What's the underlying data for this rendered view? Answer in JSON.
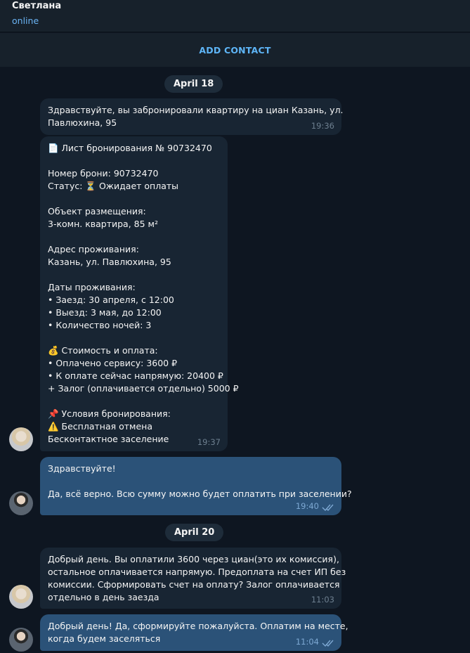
{
  "header": {
    "name": "Светлана",
    "status": "online",
    "add_contact": "ADD CONTACT"
  },
  "dates": [
    "April 18",
    "April 20"
  ],
  "messages": [
    {
      "dir": "in",
      "lines": [
        "Здравствуйте, вы забронировали квартиру на циан Казань, ул.",
        "Павлюхина, 95"
      ],
      "time": "19:36"
    },
    {
      "dir": "in",
      "lines": [
        "📄 Лист бронирования № 90732470",
        "",
        "Номер брони: 90732470",
        "Статус: ⏳ Ожидает оплаты",
        "",
        "Объект размещения:",
        "3-комн. квартира, 85 м²",
        "",
        "Адрес проживания:",
        "Казань, ул. Павлюхина, 95",
        "",
        "Даты проживания:",
        "• Заезд: 30 апреля, с 12:00",
        "• Выезд: 3 мая, до 12:00",
        "• Количество ночей: 3",
        "",
        "💰 Стоимость и оплата:",
        "• Оплачено сервису: 3600 ₽",
        "• К оплате сейчас напрямую: 20400 ₽",
        "+ Залог (оплачивается отдельно) 5000 ₽",
        "",
        "📌 Условия бронирования:",
        "⚠️ Бесплатная отмена",
        "Бесконтактное заселение"
      ],
      "time": "19:37"
    },
    {
      "dir": "out",
      "lines": [
        "Здравствуйте!",
        "",
        "Да, всё верно. Всю сумму можно будет оплатить при заселении?"
      ],
      "time": "19:40"
    },
    {
      "dir": "in",
      "lines": [
        "Добрый день. Вы оплатили 3600 через циан(это их комиссия),",
        "остальное оплачивается напрямую. Предоплата на счет ИП без",
        "комиссии. Сформировать счет на оплату? Залог оплачивается",
        "отдельно в день заезда"
      ],
      "time": "11:03"
    },
    {
      "dir": "out",
      "lines": [
        "Добрый день! Да, сформируйте пожалуйста. Оплатим на месте,",
        "когда будем заселяться"
      ],
      "time": "11:04"
    }
  ],
  "colors": {
    "background": "#0e1621",
    "incoming_bubble": "#182533",
    "outgoing_bubble": "#2b5278",
    "accent": "#5eb5f7"
  }
}
